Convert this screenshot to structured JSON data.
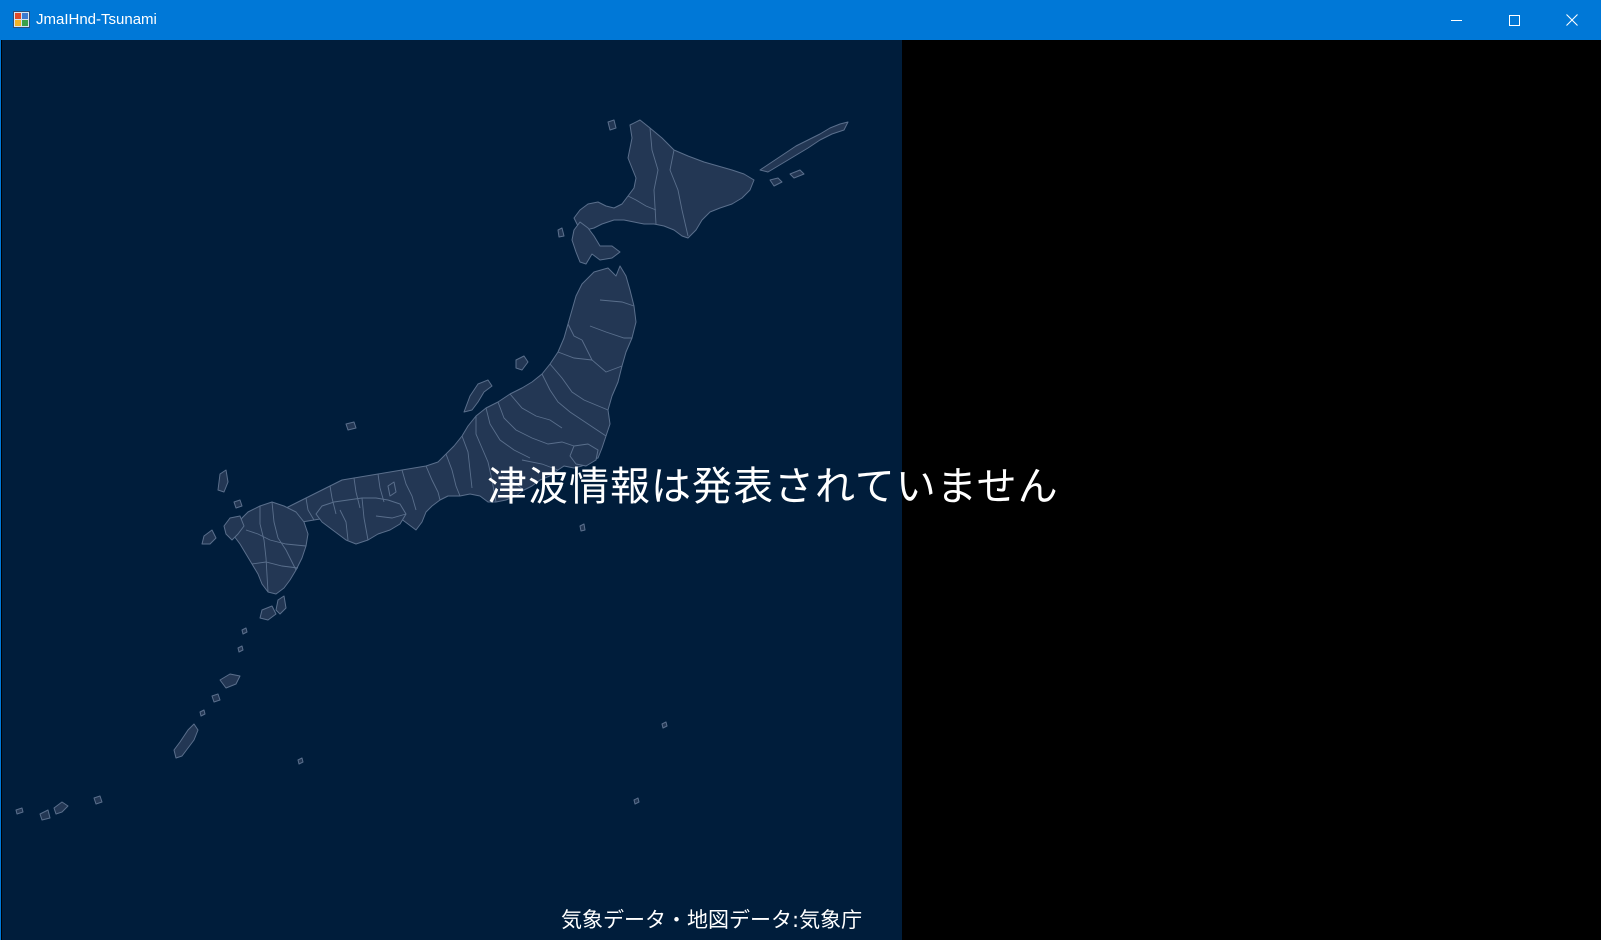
{
  "window": {
    "title": "JmaIHnd-Tsunami",
    "icon": "app-icon",
    "controls": {
      "minimize_icon": "minimize-icon",
      "maximize_icon": "maximize-icon",
      "close_icon": "close-icon"
    }
  },
  "map": {
    "region": "Japan",
    "background_color": "#001d3b",
    "land_color": "#233754",
    "border_color": "#5a6f8c"
  },
  "status": {
    "message": "津波情報は発表されていません"
  },
  "footer": {
    "credit": "気象データ・地図データ:気象庁"
  },
  "colors": {
    "titlebar": "#0078d7",
    "side_panel": "#000000",
    "text": "#ffffff"
  }
}
